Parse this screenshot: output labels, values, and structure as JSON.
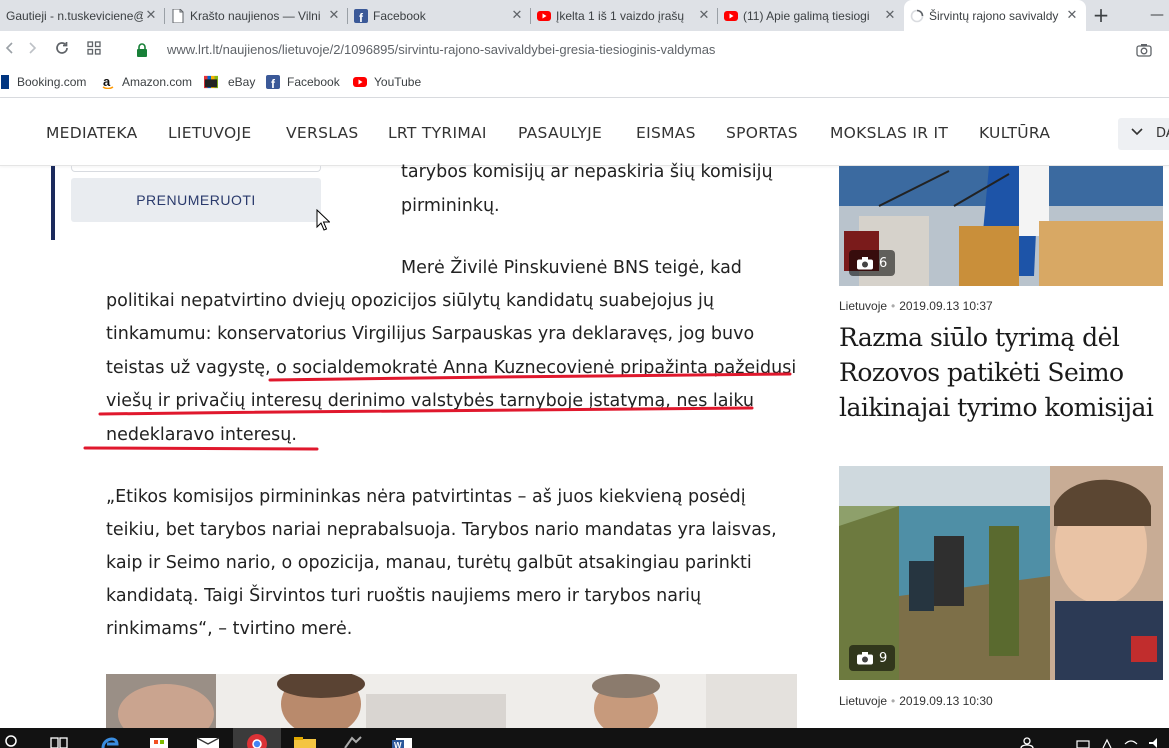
{
  "browser": {
    "tabs": [
      {
        "label": "Gautieji - n.tuskeviciene@",
        "icon": "mail-icon"
      },
      {
        "label": "Krašto naujienos — Vilni",
        "icon": "document-icon"
      },
      {
        "label": "Facebook",
        "icon": "facebook-icon"
      },
      {
        "label": "Įkelta 1 iš 1 vaizdo įrašų",
        "icon": "youtube-icon"
      },
      {
        "label": "(11) Apie galimą tiesiogi",
        "icon": "youtube-icon"
      },
      {
        "label": "Širvintų rajono savivaldy",
        "icon": "loading-icon",
        "active": true
      }
    ],
    "new_tab": "+",
    "url": "www.lrt.lt/naujienos/lietuvoje/2/1096895/sirvintu-rajono-savivaldybei-gresia-tiesioginis-valdymas"
  },
  "bookmarks": [
    {
      "label": "Booking.com",
      "icon": "booking-icon"
    },
    {
      "label": "Amazon.com",
      "icon": "amazon-icon"
    },
    {
      "label": "eBay",
      "icon": "ebay-icon"
    },
    {
      "label": "Facebook",
      "icon": "facebook-icon"
    },
    {
      "label": "YouTube",
      "icon": "youtube-icon"
    }
  ],
  "site_nav": {
    "items": [
      "MEDIATEKA",
      "LIETUVOJE",
      "VERSLAS",
      "LRT TYRIMAI",
      "PASAULYJE",
      "EISMAS",
      "SPORTAS",
      "MOKSLAS IR IT",
      "KULTŪRA"
    ],
    "more_label": "DA"
  },
  "sidebar": {
    "subscribe_label": "PRENUMERUOTI"
  },
  "article": {
    "lines": [
      "tarybos komisijų ar nepaskiria šių komisijų",
      "pirmininkų.",
      "Merė Živilė Pinskuvienė BNS teigė, kad",
      "politikai nepatvirtino dviejų opozicijos siūlytų kandidatų suabejojus jų",
      "tinkamumu: konservatorius Virgilijus Sarpauskas yra deklaravęs, jog buvo",
      "teistas už vagystę, o socialdemokratė Anna Kuznecovienė pripažinta pažeidusi",
      "viešų ir privačių interesų derinimo valstybės tarnyboje įstatymą, nes laiku",
      "nedeklaravo interesų.",
      "„Etikos komisijos pirmininkas nėra patvirtintas – aš juos kiekvieną posėdį",
      "teikiu, bet tarybos nariai neprabalsuoja. Tarybos nario mandatas yra laisvas,",
      "kaip ir Seimo nario, o opozicija, manau, turėtų galbūt atsakingiau parinkti",
      "kandidatą. Taigi Širvintos turi ruoštis naujiems mero ir tarybos narių",
      "rinkimams“, – tvirtino merė."
    ],
    "annotation_color": "#e0182d"
  },
  "right_column": {
    "cards": [
      {
        "photo_count": "6",
        "category": "Lietuvoje",
        "datetime": "2019.09.13 10:37",
        "headline": "Razma siūlo tyrimą dėl Rozovos patikėti Seimo laikinajai tyrimo komisijai"
      },
      {
        "photo_count": "9",
        "category": "Lietuvoje",
        "datetime": "2019.09.13 10:30",
        "headline": ""
      }
    ]
  },
  "colors": {
    "brand_navy": "#1b2a5c",
    "tabstrip": "#dee1e6",
    "taskbar": "#121212"
  }
}
